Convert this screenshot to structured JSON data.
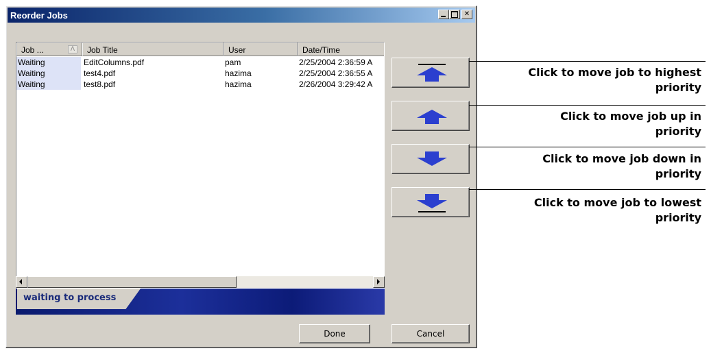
{
  "window": {
    "title": "Reorder Jobs"
  },
  "list": {
    "columns": [
      {
        "label": "Job ...",
        "sort_indicator": "Λ"
      },
      {
        "label": "Job Title"
      },
      {
        "label": "User"
      },
      {
        "label": "Date/Time"
      }
    ],
    "rows": [
      {
        "status": "Waiting",
        "title": "EditColumns.pdf",
        "user": "pam",
        "datetime": "2/25/2004 2:36:59 A"
      },
      {
        "status": "Waiting",
        "title": "test4.pdf",
        "user": "hazima",
        "datetime": "2/25/2004 2:36:55 A"
      },
      {
        "status": "Waiting",
        "title": "test8.pdf",
        "user": "hazima",
        "datetime": "2/26/2004 3:29:42 A"
      }
    ]
  },
  "tabs": {
    "active_label": "waiting to process"
  },
  "buttons": {
    "done_label": "Done",
    "cancel_label": "Cancel"
  },
  "icons": {
    "move_top": "arrow-up-bar-icon",
    "move_up": "arrow-up-icon",
    "move_down": "arrow-down-icon",
    "move_bottom": "arrow-down-bar-icon"
  },
  "colors": {
    "arrow": "#2b3fcf",
    "selection": "#dde3f7"
  },
  "callouts": [
    {
      "line1": "Click to move job to highest",
      "line2": "priority"
    },
    {
      "line1": "Click to move job up in",
      "line2": "priority"
    },
    {
      "line1": "Click to move job down in",
      "line2": "priority"
    },
    {
      "line1": "Click to move job to lowest",
      "line2": "priority"
    }
  ]
}
